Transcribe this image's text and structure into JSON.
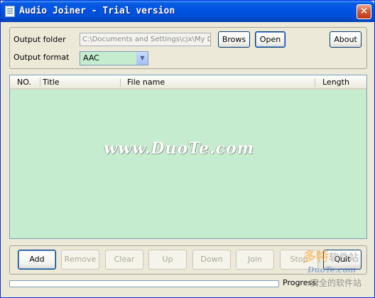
{
  "window": {
    "title": "Audio Joiner - Trial version",
    "close_glyph": "✕"
  },
  "settings": {
    "output_folder_label": "Output folder",
    "output_folder_value": "C:\\Documents and Settings\\cjx\\My D",
    "browse_label": "Brows",
    "open_label": "Open",
    "about_label": "About",
    "output_format_label": "Output format",
    "output_format_value": "AAC"
  },
  "list": {
    "columns": [
      "NO.",
      "Title",
      "File name",
      "Length"
    ],
    "rows": []
  },
  "watermark": "www.DuoTe.com",
  "buttons": {
    "add": "Add",
    "remove": "Remove",
    "clear": "Clear",
    "up": "Up",
    "down": "Down",
    "join": "Join",
    "stop": "Stop",
    "quit": "Quit"
  },
  "progress": {
    "label": "Progress:",
    "value": 0
  },
  "logo": {
    "top": "多特",
    "top_suffix": "软件站",
    "mid": "DuoTe.com",
    "bottom": "安全的软件站"
  },
  "colors": {
    "titlebar": "#0054e3",
    "window_bg": "#ece9d8",
    "list_bg": "#c6ecd0"
  }
}
